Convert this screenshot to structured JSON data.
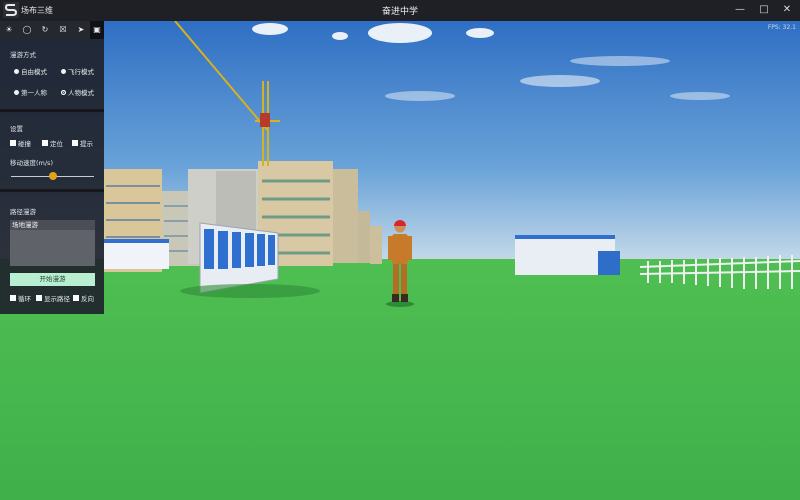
{
  "titlebar": {
    "app_name": "场布三维",
    "window_title": "奋进中学",
    "buttons": [
      "minimize",
      "maximize",
      "close"
    ]
  },
  "viewport": {
    "fps": "FPS: 32.1"
  },
  "toolbar": {
    "tools": [
      "sun-icon",
      "bulb-icon",
      "rotate-icon",
      "box-icon",
      "send-icon",
      "roam-icon"
    ],
    "active": "roam-icon"
  },
  "roam_mode": {
    "title": "漫游方式",
    "options": [
      {
        "label": "自由模式",
        "selected": false
      },
      {
        "label": "飞行模式",
        "selected": false
      },
      {
        "label": "第一人称",
        "selected": false
      },
      {
        "label": "人物模式",
        "selected": true
      }
    ]
  },
  "settings": {
    "title": "设置",
    "checks": [
      {
        "label": "碰撞",
        "checked": false
      },
      {
        "label": "定位",
        "checked": false
      },
      {
        "label": "提示",
        "checked": false
      }
    ],
    "speed_label": "移动速度(m/s)",
    "speed_fraction": 0.5
  },
  "route_roam": {
    "title": "路径漫游",
    "items": [
      "场地漫游"
    ],
    "start_label": "开始漫游",
    "checks": [
      {
        "label": "循环",
        "checked": false
      },
      {
        "label": "显示路径",
        "checked": false
      },
      {
        "label": "反向",
        "checked": false
      }
    ]
  }
}
